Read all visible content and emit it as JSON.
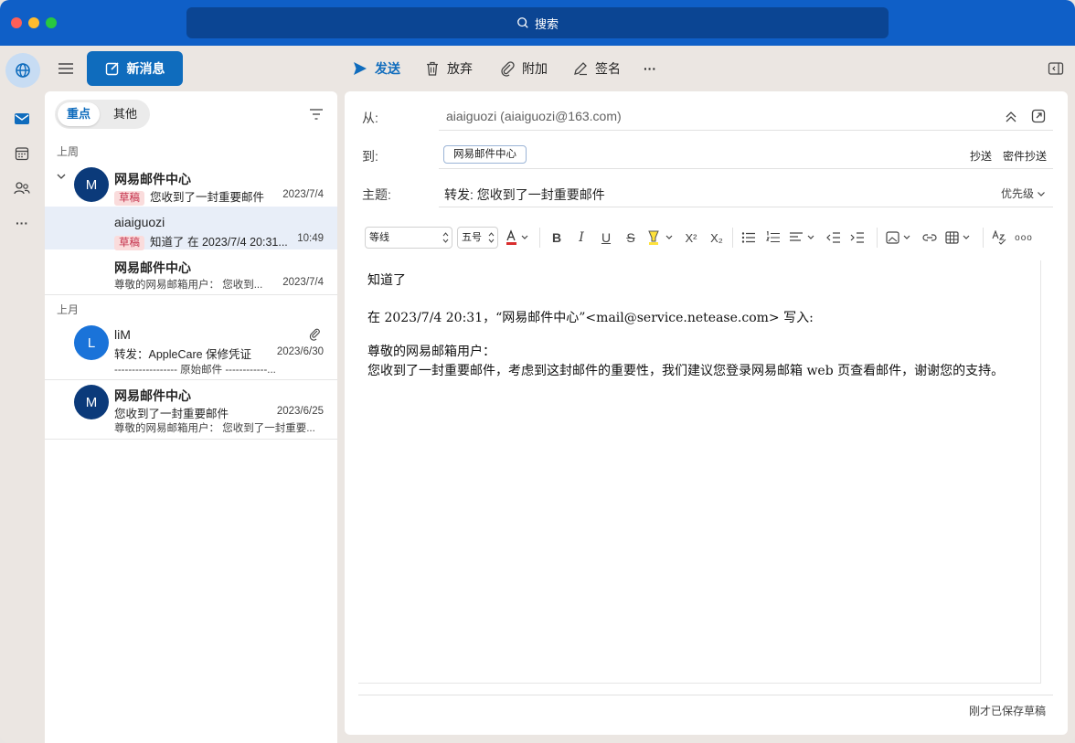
{
  "titlebar": {
    "search_label": "搜索"
  },
  "toolbar": {
    "new_message": "新消息",
    "send": "发送",
    "discard": "放弃",
    "attach": "附加",
    "signature": "签名",
    "more": "···"
  },
  "pivot": {
    "focused": "重点",
    "other": "其他"
  },
  "groups": {
    "last_week": "上周",
    "last_month": "上月"
  },
  "mails": [
    {
      "avatar": "M",
      "sender": "网易邮件中心",
      "badge": "草稿",
      "subject": "您收到了一封重要邮件",
      "date": "2023/7/4"
    },
    {
      "sender": "aiaiguozi",
      "badge": "草稿",
      "subject": "知道了 在 2023/7/4 20:31...",
      "date": "10:49"
    },
    {
      "sender": "网易邮件中心",
      "preview": "尊敬的网易邮箱用户：  您收到...",
      "date": "2023/7/4"
    },
    {
      "avatar": "L",
      "sender": "liM",
      "subject": "转发：AppleCare 保修凭证",
      "preview": "------------------ 原始邮件 ------------...",
      "date": "2023/6/30"
    },
    {
      "avatar": "M",
      "sender": "网易邮件中心",
      "subject": "您收到了一封重要邮件",
      "preview": "尊敬的网易邮箱用户：  您收到了一封重要...",
      "date": "2023/6/25"
    }
  ],
  "compose": {
    "from_label": "从:",
    "from_value": "aiaiguozi (aiaiguozi@163.com)",
    "to_label": "到:",
    "to_chip": "网易邮件中心",
    "cc": "抄送",
    "bcc": "密件抄送",
    "subject_label": "主题:",
    "subject_value": "转发: 您收到了一封重要邮件",
    "priority": "优先级",
    "font_name": "等线",
    "font_size": "五号",
    "body_line1": "知道了",
    "body_line2": "在 2023/7/4 20:31，“网易邮件中心”<mail@service.netease.com> 写入:",
    "body_line3": "尊敬的网易邮箱用户：",
    "body_line4": "您收到了一封重要邮件，考虑到这封邮件的重要性，我们建议您登录网易邮箱 web 页查看邮件，谢谢您的支持。",
    "saved_status": "刚才已保存草稿"
  },
  "colors": {
    "brand": "#0f6cbd",
    "titlebar": "#0f5fc7",
    "draft_badge": "#c4314b",
    "avatar_m": "#0b3a7a",
    "avatar_l": "#1a73d9"
  }
}
